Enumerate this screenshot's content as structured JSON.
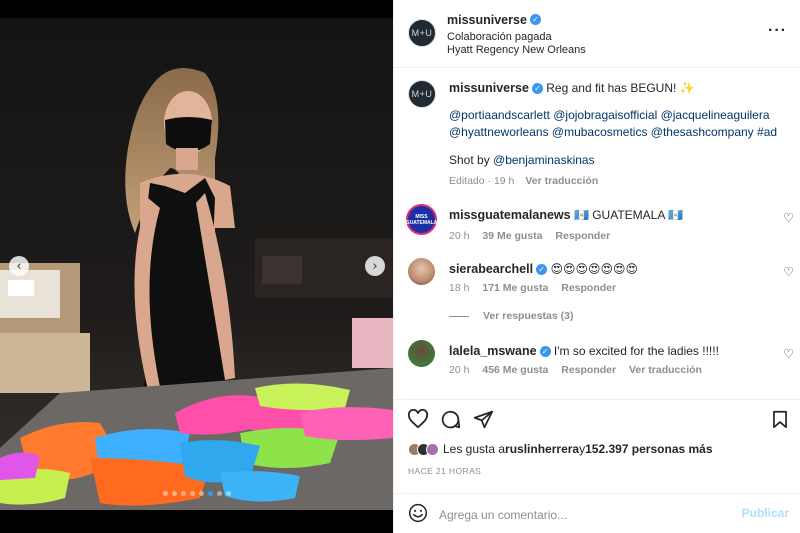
{
  "post": {
    "avatar_text": "M+U",
    "username": "missuniverse",
    "subtitle": "Colaboración pagada",
    "location": "Hyatt Regency New Orleans",
    "more_icon": "more-options-icon"
  },
  "caption": {
    "username": "missuniverse",
    "text": "Reg and fit has BEGUN! ✨",
    "tags_line1": "@portiaandscarlett @jojobragaisofficial @jacquelineaguilera",
    "tags_line2": "@hyattneworleans @mubacosmetics @thesashcompany #ad",
    "shot_by_prefix": "Shot by ",
    "shot_by_handle": "@benjaminaskinas",
    "edited": "Editado · 19 h",
    "translate": "Ver traducción"
  },
  "comments": [
    {
      "username": "missguatemalanews",
      "avatar_text": "MISS GUATEMALA",
      "text": "🇬🇹 GUATEMALA 🇬🇹",
      "time": "20 h",
      "likes": "39 Me gusta",
      "reply": "Responder",
      "verified": false
    },
    {
      "username": "sierabearchell",
      "text": "😍😍😍😍😍😍😍",
      "time": "18 h",
      "likes": "171 Me gusta",
      "reply": "Responder",
      "verified": true,
      "view_replies": "Ver respuestas (3)"
    },
    {
      "username": "lalela_mswane",
      "text": "I'm so excited for the ladies !!!!!",
      "time": "20 h",
      "likes": "456 Me gusta",
      "reply": "Responder",
      "translate": "Ver traducción",
      "verified": true
    }
  ],
  "likes_summary": {
    "prefix": "Les gusta a ",
    "user": "ruslinherrera",
    "middle": " y ",
    "count": "152.397 personas más"
  },
  "time_ago": "HACE 21 HORAS",
  "comment_box": {
    "placeholder": "Agrega un comentario...",
    "publish": "Publicar"
  },
  "carousel": {
    "slides": 8,
    "active_index": 5
  },
  "colors": {
    "verified": "#3897f0",
    "link": "#00376b",
    "publish_disabled": "#b2dffc"
  }
}
